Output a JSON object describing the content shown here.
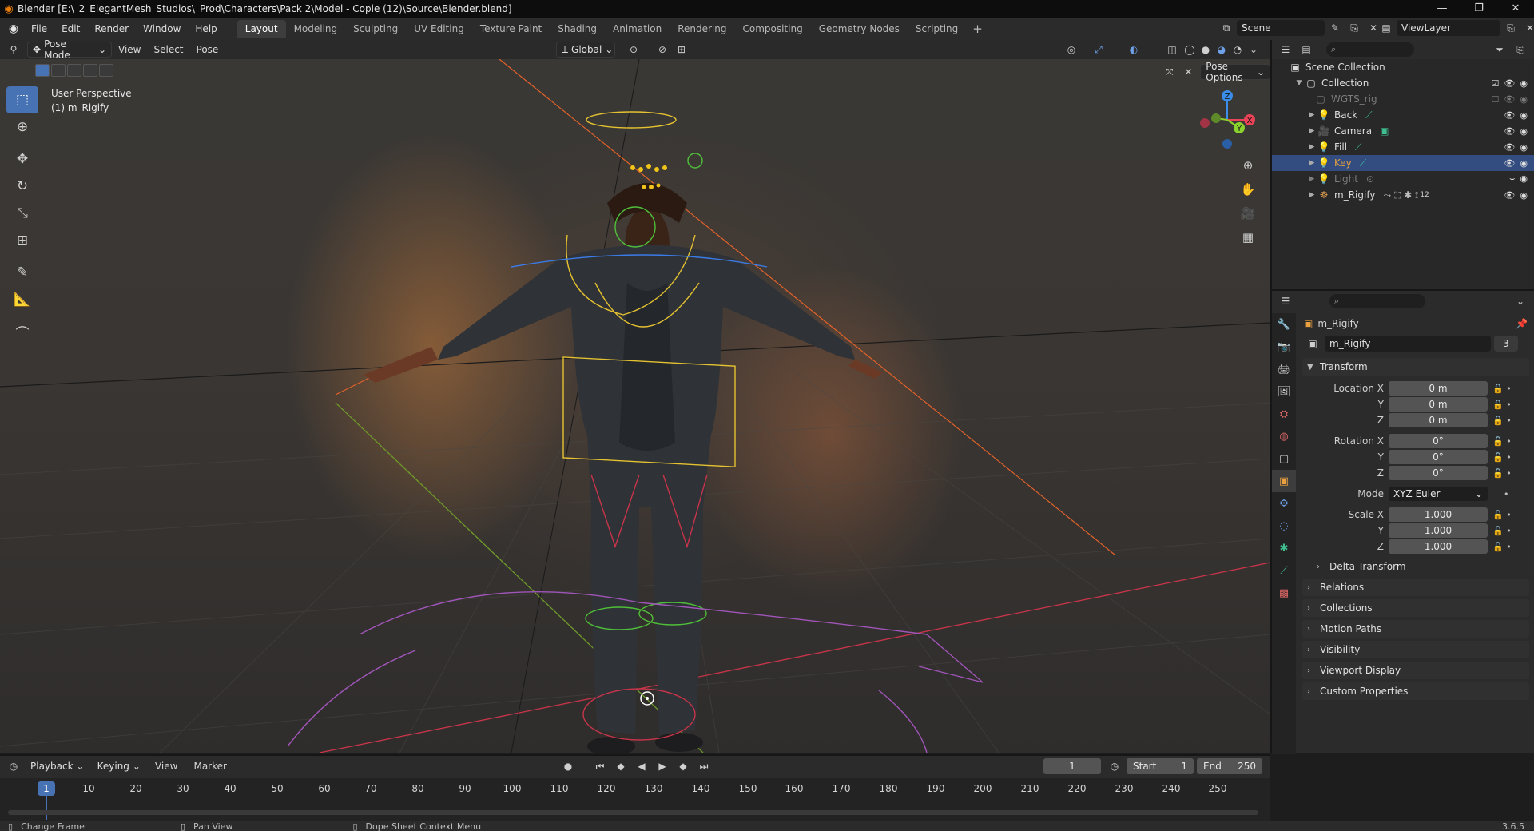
{
  "window": {
    "title": "Blender [E:\\_2_ElegantMesh_Studios\\_Prod\\Characters\\Pack 2\\Model - Copie (12)\\Source\\Blender.blend]"
  },
  "menu": {
    "items": [
      "File",
      "Edit",
      "Render",
      "Window",
      "Help"
    ]
  },
  "workspaces": {
    "tabs": [
      "Layout",
      "Modeling",
      "Sculpting",
      "UV Editing",
      "Texture Paint",
      "Shading",
      "Animation",
      "Rendering",
      "Compositing",
      "Geometry Nodes",
      "Scripting"
    ],
    "active": "Layout",
    "add_label": "+"
  },
  "scene": {
    "name": "Scene",
    "view_layer": "ViewLayer"
  },
  "viewport_header": {
    "mode": "Pose Mode",
    "menus": [
      "View",
      "Select",
      "Pose"
    ],
    "transform_orientation": "Global"
  },
  "viewport": {
    "perspective_label": "User Perspective",
    "object_label": "(1) m_Rigify",
    "pose_options_label": "Pose Options",
    "gizmo_axes": {
      "x": "X",
      "y": "Y",
      "z": "Z"
    }
  },
  "outliner": {
    "root": "Scene Collection",
    "collection": "Collection",
    "items": [
      {
        "name": "WGTS_rig",
        "dim": true
      },
      {
        "name": "Back",
        "dim": false
      },
      {
        "name": "Camera",
        "dim": false
      },
      {
        "name": "Fill",
        "dim": false
      },
      {
        "name": "Key",
        "dim": false,
        "selected": true
      },
      {
        "name": "Light",
        "dim": true
      },
      {
        "name": "m_Rigify",
        "dim": false,
        "badge": "12"
      }
    ]
  },
  "properties": {
    "object_name": "m_Rigify",
    "data_name": "m_Rigify",
    "user_count": "3",
    "transform_label": "Transform",
    "location": {
      "label": "Location X",
      "x": "0 m",
      "y": "0 m",
      "z": "0 m"
    },
    "rotation": {
      "label": "Rotation X",
      "x": "0°",
      "y": "0°",
      "z": "0°"
    },
    "mode": {
      "label": "Mode",
      "value": "XYZ Euler"
    },
    "scale": {
      "label": "Scale X",
      "x": "1.000",
      "y": "1.000",
      "z": "1.000"
    },
    "axis_y": "Y",
    "axis_z": "Z",
    "sections": [
      "Delta Transform",
      "Relations",
      "Collections",
      "Motion Paths",
      "Visibility",
      "Viewport Display",
      "Custom Properties"
    ]
  },
  "timeline": {
    "menus": [
      "Playback",
      "Keying",
      "View",
      "Marker"
    ],
    "current_frame": "1",
    "start_label": "Start",
    "start": "1",
    "end_label": "End",
    "end": "250",
    "ticks": [
      "10",
      "20",
      "30",
      "40",
      "50",
      "60",
      "70",
      "80",
      "90",
      "100",
      "110",
      "120",
      "130",
      "140",
      "150",
      "160",
      "170",
      "180",
      "190",
      "200",
      "210",
      "220",
      "230",
      "240",
      "250"
    ]
  },
  "statusbar": {
    "change_frame": "Change Frame",
    "pan_view": "Pan View",
    "context_menu": "Dope Sheet Context Menu",
    "version": "3.6.5"
  },
  "colors": {
    "accent": "#4772b3",
    "selected_row": "#334d80",
    "x_axis": "#e84357",
    "y_axis": "#8bd22e",
    "z_axis": "#3b8dea"
  }
}
